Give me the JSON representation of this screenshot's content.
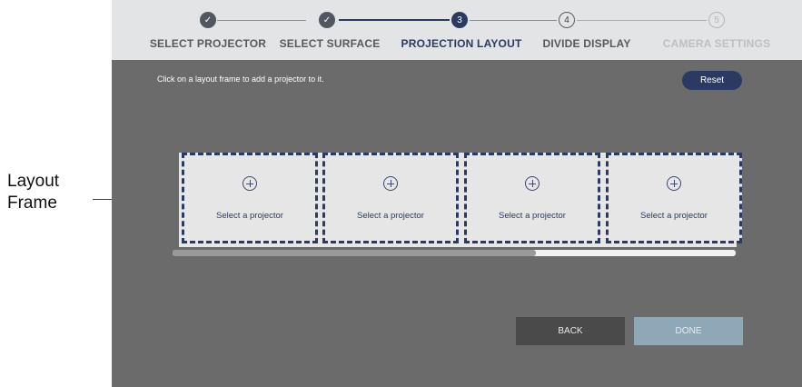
{
  "annotation": {
    "label_line1": "Layout",
    "label_line2": "Frame"
  },
  "stepper": {
    "steps": [
      {
        "number": "1",
        "label": "SELECT PROJECTOR",
        "state": "done",
        "icon": "check-icon"
      },
      {
        "number": "2",
        "label": "SELECT SURFACE",
        "state": "done",
        "icon": "check-icon"
      },
      {
        "number": "3",
        "label": "PROJECTION LAYOUT",
        "state": "current"
      },
      {
        "number": "4",
        "label": "DIVIDE DISPLAY",
        "state": "todo"
      },
      {
        "number": "5",
        "label": "CAMERA SETTINGS",
        "state": "future"
      }
    ]
  },
  "main": {
    "instruction": "Click on a layout frame to add a projector to it.",
    "reset_label": "Reset",
    "frames": [
      {
        "label": "Select a projector",
        "icon": "plus-circle-icon"
      },
      {
        "label": "Select a projector",
        "icon": "plus-circle-icon"
      },
      {
        "label": "Select a projector",
        "icon": "plus-circle-icon"
      },
      {
        "label": "Select a projector",
        "icon": "plus-circle-icon"
      }
    ],
    "scroll_position_fraction": 0.65
  },
  "footer": {
    "back_label": "BACK",
    "done_label": "DONE"
  },
  "colors": {
    "accent": "#2b3a63",
    "background": "#6b6b6b",
    "stepper_bg": "#e3e4e5",
    "done_button": "#8fa8b7",
    "back_button": "#4a4a4a",
    "annotation": "#e00000"
  }
}
